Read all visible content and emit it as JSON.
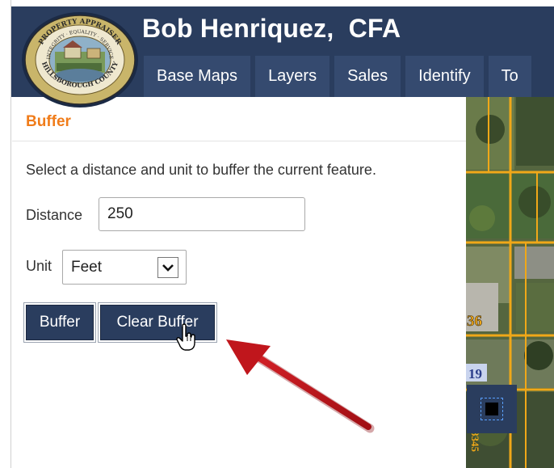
{
  "header": {
    "title": "Bob Henriquez,  CFA",
    "logo_text": {
      "top": "PROPERTY APPRAISER",
      "middle": "INTEGRITY · EQUALITY · SERVICE",
      "bottom": "HILLSBOROUGH COUNTY"
    }
  },
  "nav": {
    "items": [
      "Base Maps",
      "Layers",
      "Sales",
      "Identify",
      "To"
    ]
  },
  "panel": {
    "title": "Buffer",
    "instructions": "Select a distance and unit to buffer the current feature.",
    "distance_label": "Distance",
    "distance_value": "250",
    "unit_label": "Unit",
    "unit_value": "Feet",
    "buffer_button": "Buffer",
    "clear_button": "Clear Buffer"
  },
  "map": {
    "parcel_labels": [
      "36",
      "19",
      "8345"
    ]
  },
  "colors": {
    "header_bg": "#2a3d5e",
    "nav_bg": "#354a6f",
    "panel_title": "#f07c1a",
    "button_bg": "#2a3d5e",
    "annotation_arrow": "#c0161c",
    "parcel_lines": "#f0a818"
  },
  "icons": {
    "dropdown": "chevron-down-icon",
    "cursor": "hand-pointer-icon",
    "map_tool": "square-select-icon"
  }
}
